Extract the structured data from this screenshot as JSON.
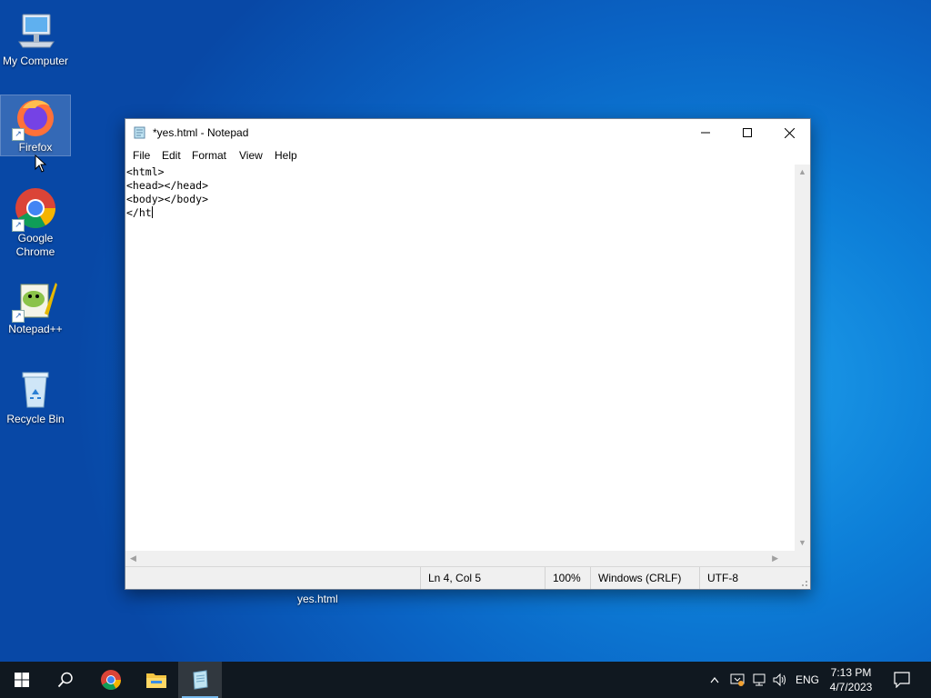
{
  "desktop": {
    "icons": [
      {
        "label": "My Computer",
        "icon": "computer-icon"
      },
      {
        "label": "Firefox",
        "icon": "firefox-icon"
      },
      {
        "label": "Google Chrome",
        "icon": "chrome-icon"
      },
      {
        "label": "Notepad++",
        "icon": "notepadpp-icon"
      },
      {
        "label": "Recycle Bin",
        "icon": "recycle-bin-icon"
      }
    ],
    "file_label": "yes.html"
  },
  "notepad": {
    "title": "*yes.html - Notepad",
    "menu": [
      "File",
      "Edit",
      "Format",
      "View",
      "Help"
    ],
    "lines": [
      "<html>",
      "<head></head>",
      "<body></body>",
      "</ht"
    ],
    "status": {
      "position": "Ln 4, Col 5",
      "zoom": "100%",
      "line_ending": "Windows (CRLF)",
      "encoding": "UTF-8"
    }
  },
  "taskbar": {
    "items": [
      "start-icon",
      "search-icon",
      "chrome-icon",
      "file-explorer-icon",
      "notepad-icon"
    ],
    "tray": {
      "language": "ENG"
    },
    "clock": {
      "time": "7:13 PM",
      "date": "4/7/2023"
    }
  },
  "colors": {
    "taskbar": "#101820",
    "accent": "#76b9ed",
    "desktop": "#0a63c4"
  }
}
